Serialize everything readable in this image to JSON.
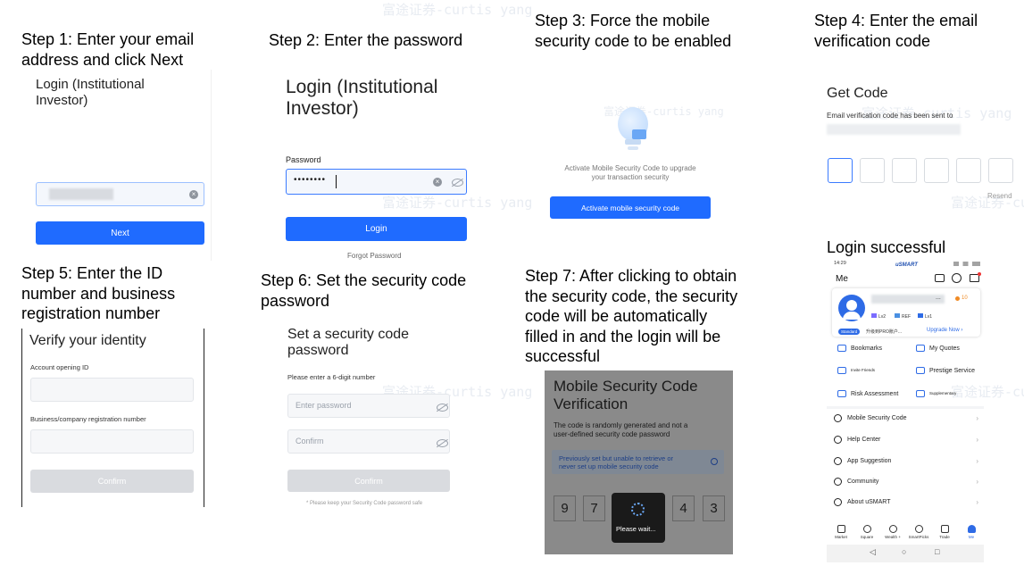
{
  "watermark": "富途证券-curtis yang",
  "steps": {
    "s1": "Step 1: Enter your email\naddress and click Next",
    "s2": "Step 2: Enter the password",
    "s3": "Step 3: Force the mobile\nsecurity code to be enabled",
    "s4": "Step 4: Enter the email\nverification code",
    "s5": "Step 5: Enter the ID\nnumber and business\nregistration number",
    "s6": "Step 6: Set the security code\npassword",
    "s7": "Step 7: After clicking to obtain\nthe security code, the security\ncode will be automatically\nfilled in and the login will be\nsuccessful",
    "success": "Login successful"
  },
  "screen1": {
    "title": "Login (Institutional\nInvestor)",
    "next": "Next"
  },
  "screen2": {
    "title": "Login (Institutional\nInvestor)",
    "password_label": "Password",
    "password_value": "••••••••",
    "login": "Login",
    "forgot": "Forgot Password"
  },
  "screen3": {
    "message": "Activate Mobile Security Code to upgrade\nyour transaction security",
    "button": "Activate mobile security code"
  },
  "screen4": {
    "title": "Get Code",
    "subtitle": "Email verification code has been sent to",
    "resend": "Resend"
  },
  "screen5": {
    "title": "Verify your identity",
    "field1": "Account opening ID",
    "field2": "Business/company registration number",
    "confirm": "Confirm"
  },
  "screen6": {
    "title": "Set a security code\npassword",
    "hint": "Please enter a 6-digit number",
    "enter_placeholder": "Enter password",
    "confirm_placeholder": "Confirm",
    "confirm_button": "Confirm",
    "note": "* Please keep your Security Code password safe"
  },
  "screen7": {
    "title": "Mobile Security Code\nVerification",
    "desc": "The code is randomly generated and not a\nuser-defined security code password",
    "notice": "Previously set but unable to retrieve or\nnever set up mobile security code",
    "digits": [
      "9",
      "7",
      "4",
      "3"
    ],
    "wait": "Please wait..."
  },
  "screen8": {
    "time": "14:29",
    "brand": "uSMART",
    "me": "Me",
    "upgrade": "Upgrade Now ›",
    "badge_lv": "Lv2",
    "badge_ref": "REF",
    "badge_lv1": "Lv1",
    "standard": "Standard",
    "upgrade_cn": "升级到PRO账户...",
    "points": "10",
    "grid": [
      "Bookmarks",
      "My Quotes",
      "Invite Friends",
      "Prestige Service",
      "Risk Assessment",
      "Supplementary"
    ],
    "menu": [
      "Mobile Security Code",
      "Help Center",
      "App Suggestion",
      "Community",
      "About uSMART"
    ],
    "nav": [
      "Market",
      "Square",
      "Wealth +",
      "SmartPicks",
      "Trade",
      "Me"
    ]
  }
}
